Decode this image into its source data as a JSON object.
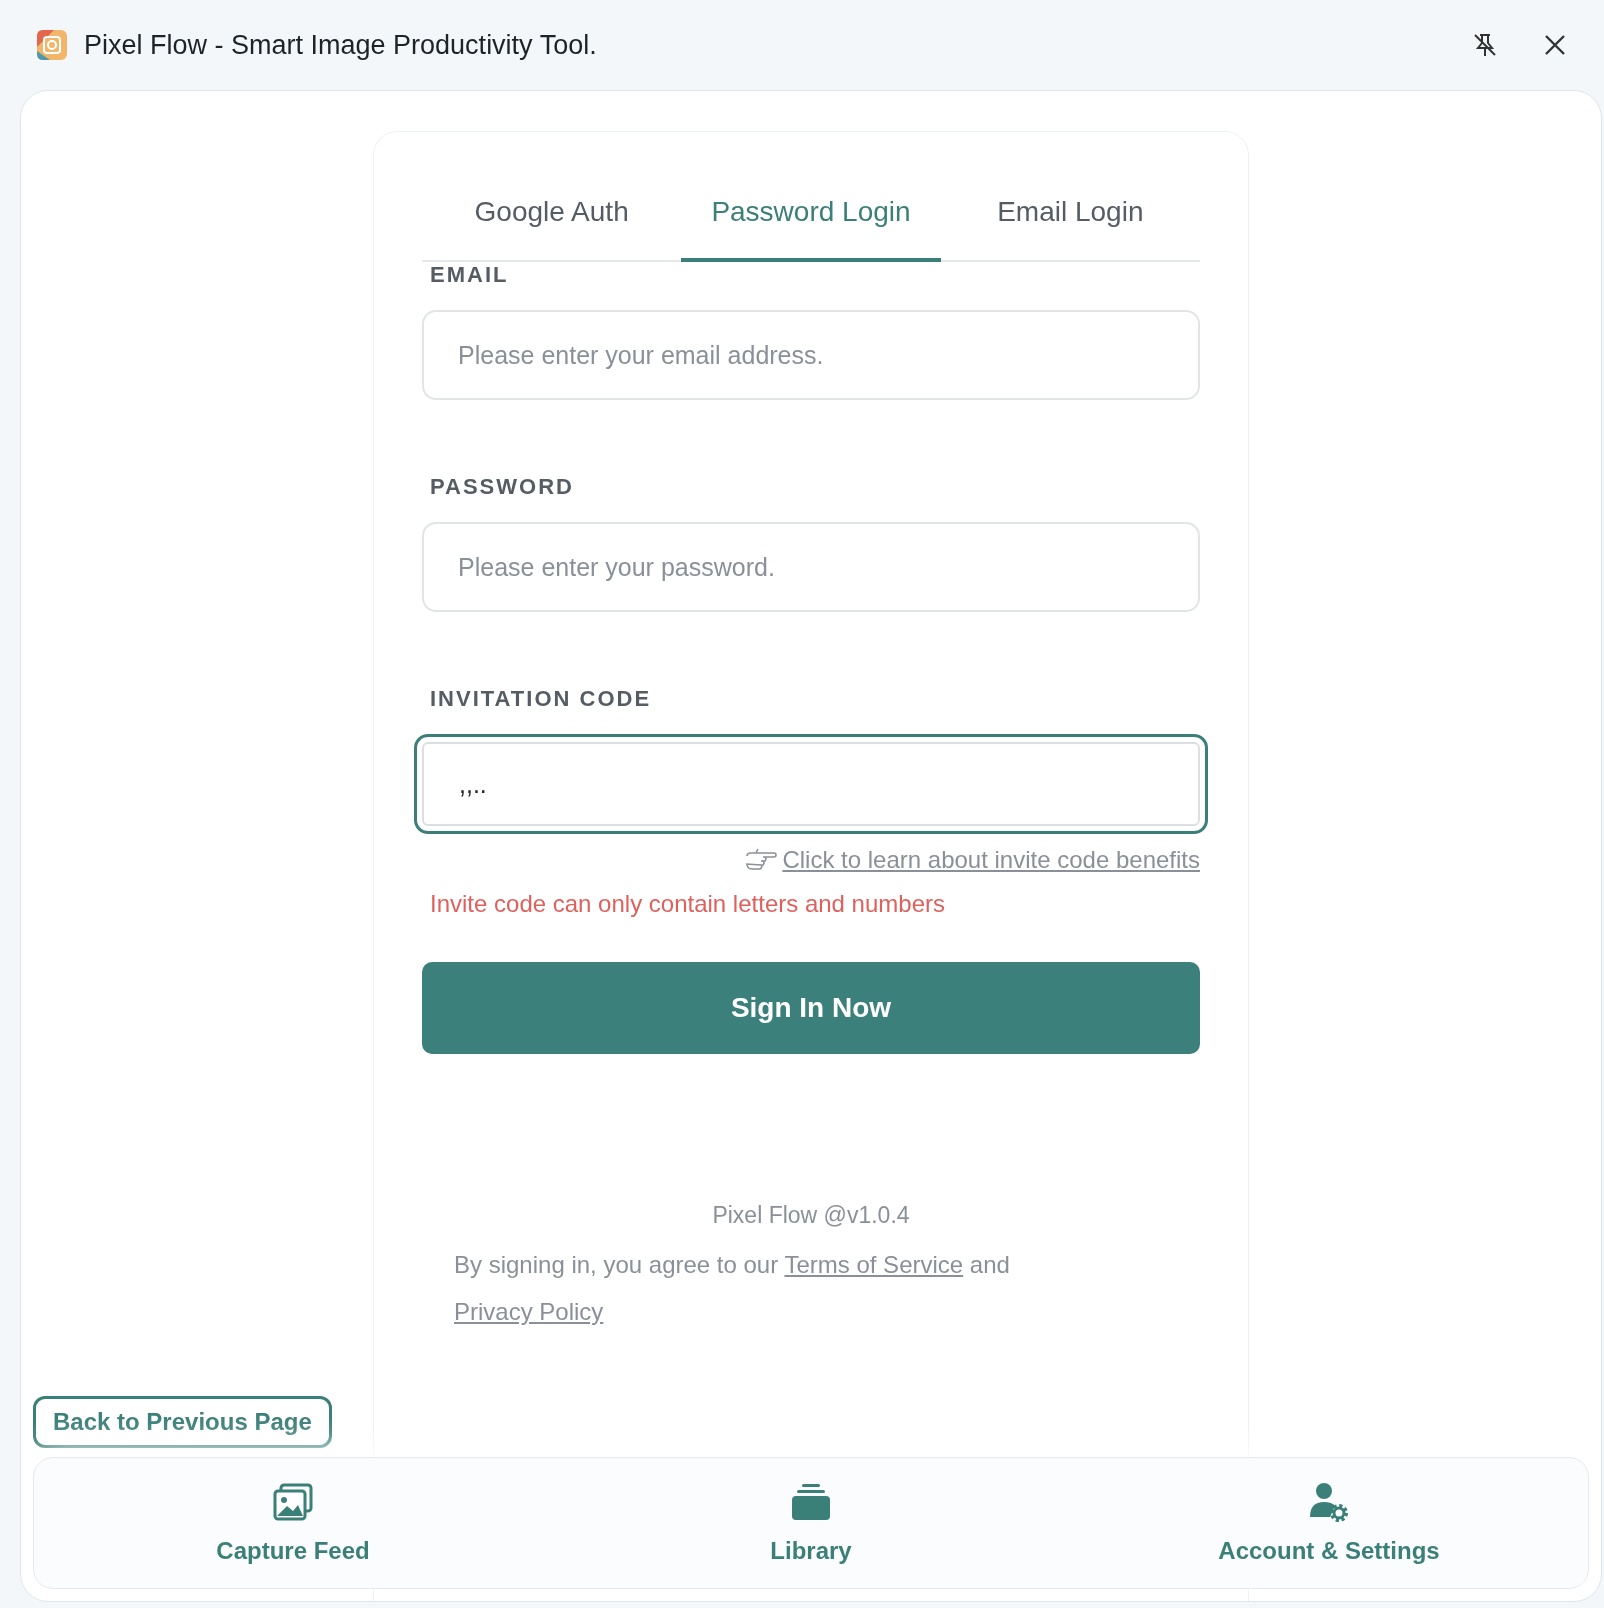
{
  "window": {
    "title": "Pixel Flow - Smart Image Productivity Tool."
  },
  "tabs": [
    {
      "label": "Google Auth",
      "selected": false
    },
    {
      "label": "Password Login",
      "selected": true
    },
    {
      "label": "Email Login",
      "selected": false
    }
  ],
  "fields": [
    {
      "label": "EMAIL",
      "placeholder": "Please enter your email address.",
      "focused": false
    },
    {
      "label": "PASSWORD",
      "placeholder": "Please enter your password.",
      "focused": false
    },
    {
      "label": "INVITATION CODE",
      "value": ",,..",
      "focused": true
    }
  ],
  "invite_hint_link": "Click to learn about invite code benefits",
  "error": "Invite code can only contain letters and numbers",
  "submit_button": "Sign In Now",
  "version": "Pixel Flow @v1.0.4",
  "agreement": {
    "text_before": "By signing in, you agree to our ",
    "terms_link": "Terms of Service",
    "text_between": " and",
    "privacy_link": "Privacy Policy"
  },
  "back_button": "Back to Previous Page",
  "nav": [
    {
      "kind": "images",
      "label": "Capture Feed"
    },
    {
      "kind": "library",
      "label": "Library"
    },
    {
      "kind": "account",
      "label": "Account & Settings"
    }
  ]
}
